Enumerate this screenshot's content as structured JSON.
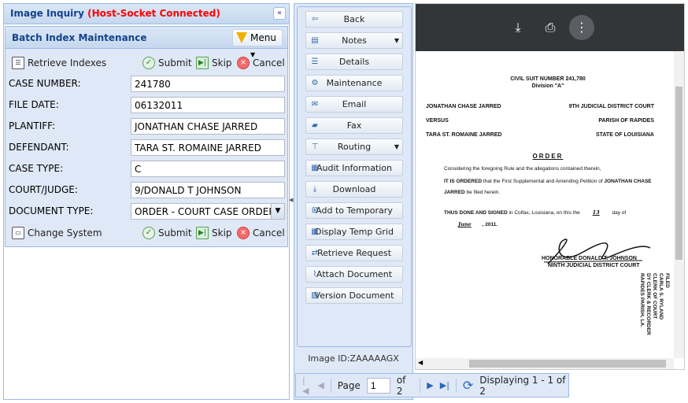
{
  "left_panel": {
    "title": "Image Inquiry",
    "status": "(Host-Socket Connected)",
    "section_title": "Batch Index Maintenance",
    "menu_label": "Menu",
    "toolbar": {
      "retrieve": "Retrieve Indexes",
      "submit": "Submit",
      "skip": "Skip",
      "cancel": "Cancel"
    },
    "fields": [
      {
        "label": "CASE NUMBER:",
        "value": "241780"
      },
      {
        "label": "FILE DATE:",
        "value": "06132011"
      },
      {
        "label": "PLANTIFF:",
        "value": "JONATHAN CHASE JARRED"
      },
      {
        "label": "DEFENDANT:",
        "value": "TARA ST. ROMAINE JARRED"
      },
      {
        "label": "CASE TYPE:",
        "value": "C"
      },
      {
        "label": "COURT/JUDGE:",
        "value": "9/DONALD T JOHNSON"
      },
      {
        "label": "DOCUMENT TYPE:",
        "value": "ORDER - COURT CASE ORDER"
      }
    ],
    "bottom_toolbar": {
      "change_system": "Change System",
      "submit": "Submit",
      "skip": "Skip",
      "cancel": "Cancel"
    }
  },
  "actions": [
    {
      "label": "Back",
      "icon": "back-arrow-icon",
      "dropdown": false
    },
    {
      "label": "Notes",
      "icon": "notes-icon",
      "dropdown": true
    },
    {
      "label": "Details",
      "icon": "details-icon",
      "dropdown": false
    },
    {
      "label": "Maintenance",
      "icon": "gears-icon",
      "dropdown": false
    },
    {
      "label": "Email",
      "icon": "envelope-icon",
      "dropdown": false
    },
    {
      "label": "Fax",
      "icon": "fax-icon",
      "dropdown": false
    },
    {
      "label": "Routing",
      "icon": "routing-icon",
      "dropdown": true
    },
    {
      "label": "Audit Information",
      "icon": "audit-icon",
      "dropdown": false
    },
    {
      "label": "Download",
      "icon": "download-icon",
      "dropdown": false
    },
    {
      "label": "Add to Temporary",
      "icon": "add-icon",
      "dropdown": false
    },
    {
      "label": "Display Temp Grid",
      "icon": "grid-icon",
      "dropdown": false
    },
    {
      "label": "Retrieve Request",
      "icon": "request-icon",
      "dropdown": false
    },
    {
      "label": "Attach Document",
      "icon": "paperclip-icon",
      "dropdown": false
    },
    {
      "label": "Version Document",
      "icon": "version-icon",
      "dropdown": false
    }
  ],
  "image_id": "Image ID:ZAAAAAGX",
  "document": {
    "title": "CIVIL SUIT NUMBER 241,780",
    "division": "Division \"A\"",
    "left": [
      "JONATHAN CHASE JARRED",
      "VERSUS",
      "TARA ST. ROMAINE JARRED"
    ],
    "right": [
      "9TH JUDICIAL DISTRICT COURT",
      "PARISH OF RAPIDES",
      "STATE OF LOUISIANA"
    ],
    "heading": "ORDER",
    "p1": "Considering the foregoing Rule and the allegations contained therein,",
    "p2a": "IT IS ORDERED",
    "p2b": " that the First Supplemental and Amending Petition of ",
    "p2c": "JONATHAN CHASE JARRED",
    "p2d": " be filed herein.",
    "p3a": "THUS DONE AND SIGNED",
    "p3b": " in Colfax, Louisiana, on this the ",
    "day": "13",
    "p3c": " day of ",
    "month": "June",
    "year": ", 2011.",
    "judge": "HONORABLE DONALD T. JOHNSON",
    "court": "NINTH JUDICIAL DISTRICT COURT",
    "stamp": [
      "FILED",
      "CARLA S. RYLAND",
      "CLERK OF COURT",
      "DY CLERK & RECORDER",
      "RAPIDES PARISH, LA."
    ]
  },
  "pager": {
    "page_label": "Page",
    "page_value": "1",
    "of": "of 2",
    "display": "Displaying 1 - 1 of 2"
  }
}
